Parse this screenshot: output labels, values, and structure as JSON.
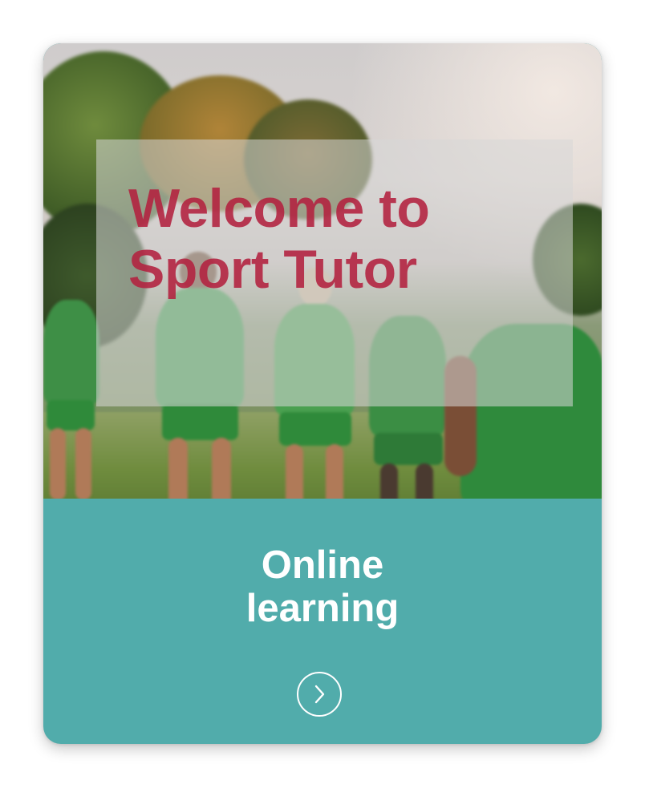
{
  "card": {
    "hero": {
      "title_line1": "Welcome to",
      "title_line2": "Sport Tutor",
      "title_color": "#b3213f"
    },
    "title_line1": "Online",
    "title_line2": "learning",
    "background_color": "#51acab",
    "arrow_icon": "chevron-right-icon"
  }
}
